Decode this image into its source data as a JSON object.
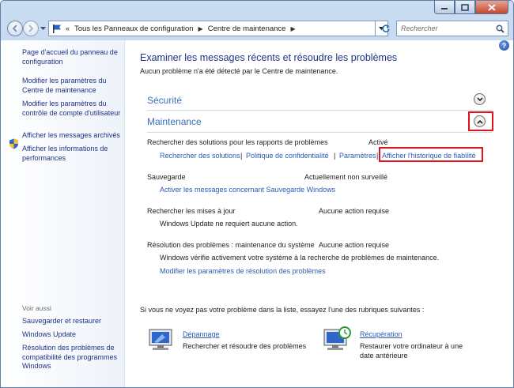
{
  "address": {
    "crumbs": [
      "Tous les Panneaux de configuration",
      "Centre de maintenance"
    ]
  },
  "search": {
    "placeholder": "Rechercher"
  },
  "sidebar": {
    "links": [
      "Page d'accueil du panneau de configuration",
      "Modifier les paramètres du Centre de maintenance",
      "Modifier les paramètres du contrôle de compte d'utilisateur",
      "Afficher les messages archivés",
      "Afficher les informations de performances"
    ],
    "see_also_header": "Voir aussi",
    "see_also": [
      "Sauvegarder et restaurer",
      "Windows Update",
      "Résolution des problèmes de compatibilité des programmes Windows"
    ]
  },
  "main": {
    "title": "Examiner les messages récents et résoudre les problèmes",
    "subtitle": "Aucun problème n'a été détecté par le Centre de maintenance.",
    "security_header": "Sécurité",
    "maintenance_header": "Maintenance",
    "rows": {
      "solutions_label": "Rechercher des solutions pour les rapports de problèmes",
      "solutions_status": "Activé",
      "solutions_links": [
        "Rechercher des solutions",
        "Politique de confidentialité",
        "Paramètres",
        "Afficher l'historique de fiabilité"
      ],
      "backup_label": "Sauvegarde",
      "backup_status": "Actuellement non surveillé",
      "backup_link": "Activer les messages concernant Sauvegarde Windows",
      "updates_label": "Rechercher les mises à jour",
      "updates_status": "Aucune action requise",
      "updates_desc": "Windows Update ne requiert aucune action.",
      "troubleshoot_label": "Résolution des problèmes : maintenance du système",
      "troubleshoot_status": "Aucune action requise",
      "troubleshoot_desc": "Windows vérifie activement votre système à la recherche de problèmes de maintenance.",
      "troubleshoot_link": "Modifier les paramètres de résolution des problèmes"
    },
    "bottom_title": "Si vous ne voyez pas votre problème dans la liste, essayez l'une des rubriques suivantes :",
    "tiles": [
      {
        "title": "Dépannage",
        "desc": "Rechercher et résoudre des problèmes"
      },
      {
        "title": "Récupération",
        "desc": "Restaurer votre ordinateur à une date antérieure"
      }
    ]
  },
  "colors": {
    "link": "#2a5bb7",
    "heading": "#1e3287",
    "highlight": "#e0121e"
  }
}
